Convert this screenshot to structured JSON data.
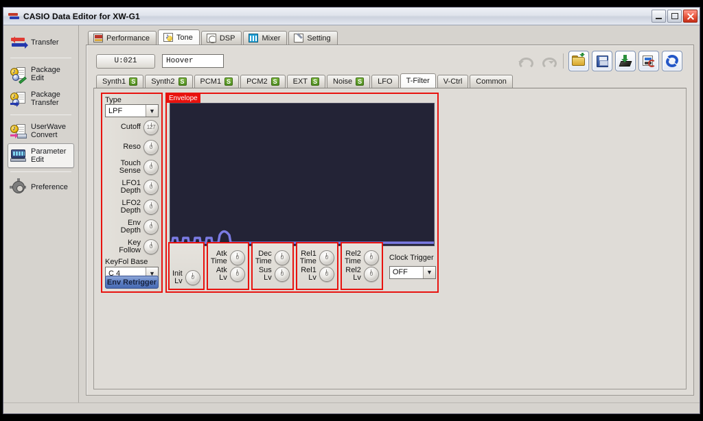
{
  "window": {
    "title": "CASIO Data Editor for XW-G1",
    "icon": "transfer-arrows-icon",
    "controls": {
      "minimize": "minimize-button",
      "maximize": "maximize-button",
      "close": "close-button"
    }
  },
  "sidebar": {
    "items": [
      {
        "label_line1": "Transfer",
        "label_line2": "",
        "icon": "transfer-icon",
        "selected": false
      },
      {
        "label_line1": "Package",
        "label_line2": "Edit",
        "icon": "package-edit-icon",
        "selected": false
      },
      {
        "label_line1": "Package",
        "label_line2": "Transfer",
        "icon": "package-transfer-icon",
        "selected": false
      },
      {
        "label_line1": "UserWave",
        "label_line2": "Convert",
        "icon": "userwave-convert-icon",
        "selected": false
      },
      {
        "label_line1": "Parameter",
        "label_line2": "Edit",
        "icon": "parameter-edit-icon",
        "selected": true
      },
      {
        "label_line1": "Preference",
        "label_line2": "",
        "icon": "gear-icon",
        "selected": false
      }
    ]
  },
  "main_tabs": [
    {
      "label": "Performance",
      "icon": "performance-icon",
      "active": false
    },
    {
      "label": "Tone",
      "icon": "tone-icon",
      "active": true
    },
    {
      "label": "DSP",
      "icon": "dsp-icon",
      "active": false
    },
    {
      "label": "Mixer",
      "icon": "mixer-icon",
      "active": false
    },
    {
      "label": "Setting",
      "icon": "setting-icon",
      "active": false
    }
  ],
  "tone_header": {
    "number": "U:021",
    "name_value": "Hoover"
  },
  "toolbar": {
    "buttons": [
      {
        "name": "undo-button",
        "icon": "undo-arrow-icon",
        "enabled": false
      },
      {
        "name": "redo-button",
        "icon": "redo-arrow-icon",
        "enabled": false
      },
      {
        "name": "open-button",
        "icon": "open-folder-icon",
        "enabled": true
      },
      {
        "name": "save-button",
        "icon": "floppy-save-icon",
        "enabled": true
      },
      {
        "name": "write-button",
        "icon": "download-chip-icon",
        "enabled": true
      },
      {
        "name": "restore-button",
        "icon": "restore-doc-icon",
        "enabled": true
      },
      {
        "name": "sync-button",
        "icon": "sync-refresh-icon",
        "enabled": true
      }
    ]
  },
  "sub_tabs": [
    {
      "label": "Synth1",
      "badge": "S",
      "active": false
    },
    {
      "label": "Synth2",
      "badge": "S",
      "active": false
    },
    {
      "label": "PCM1",
      "badge": "S",
      "active": false
    },
    {
      "label": "PCM2",
      "badge": "S",
      "active": false
    },
    {
      "label": "EXT",
      "badge": "S",
      "active": false
    },
    {
      "label": "Noise",
      "badge": "S",
      "active": false
    },
    {
      "label": "LFO",
      "badge": "",
      "active": false
    },
    {
      "label": "T-Filter",
      "badge": "",
      "active": true
    },
    {
      "label": "V-Ctrl",
      "badge": "",
      "active": false
    },
    {
      "label": "Common",
      "badge": "",
      "active": false
    }
  ],
  "filter_panel": {
    "type_label": "Type",
    "type_value": "LPF",
    "params": [
      {
        "name_line1": "Cutoff",
        "name_line2": "",
        "value": "127"
      },
      {
        "name_line1": "Reso",
        "name_line2": "",
        "value": "0"
      },
      {
        "name_line1": "Touch",
        "name_line2": "Sense",
        "value": "0"
      },
      {
        "name_line1": "LFO1",
        "name_line2": "Depth",
        "value": "0"
      },
      {
        "name_line1": "LFO2",
        "name_line2": "Depth",
        "value": "0"
      },
      {
        "name_line1": "Env",
        "name_line2": "Depth",
        "value": "0"
      },
      {
        "name_line1": "Key",
        "name_line2": "Follow",
        "value": "0"
      }
    ],
    "keyfol_label": "KeyFol Base",
    "keyfol_value": "C    4",
    "env_retrigger_label": "Env Retrigger"
  },
  "envelope": {
    "title": "Envelope",
    "graph_bg": "#232336",
    "curve_color": "#7b7be4",
    "groups": [
      {
        "name": "init-group",
        "rows": [
          {
            "label_line1": "Init",
            "label_line2": "Lv",
            "value": "0"
          }
        ]
      },
      {
        "name": "attack-group",
        "rows": [
          {
            "label_line1": "Atk",
            "label_line2": "Time",
            "value": "0"
          },
          {
            "label_line1": "Atk",
            "label_line2": "Lv",
            "value": "0"
          }
        ]
      },
      {
        "name": "decay-group",
        "rows": [
          {
            "label_line1": "Dec",
            "label_line2": "Time",
            "value": "0"
          },
          {
            "label_line1": "Sus",
            "label_line2": "Lv",
            "value": "0"
          }
        ]
      },
      {
        "name": "release1-group",
        "rows": [
          {
            "label_line1": "Rel1",
            "label_line2": "Time",
            "value": "0"
          },
          {
            "label_line1": "Rel1",
            "label_line2": "Lv",
            "value": "0"
          }
        ]
      },
      {
        "name": "release2-group",
        "rows": [
          {
            "label_line1": "Rel2",
            "label_line2": "Time",
            "value": "0"
          },
          {
            "label_line1": "Rel2",
            "label_line2": "Lv",
            "value": "0"
          }
        ]
      }
    ],
    "clock_trigger_label": "Clock Trigger",
    "clock_trigger_value": "OFF"
  },
  "colors": {
    "highlight_red": "#e8120e",
    "badge_green": "#4e8c1f",
    "accent_blue": "#4a6cb4",
    "window_bg": "#d6d3ce"
  }
}
